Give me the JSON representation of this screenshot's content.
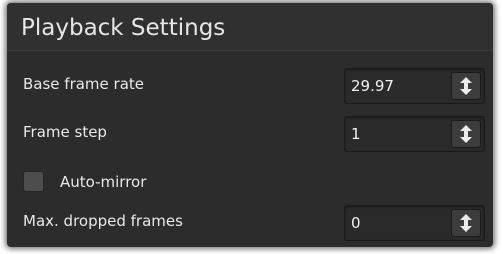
{
  "panel": {
    "title": "Playback Settings"
  },
  "settings": {
    "base_frame_rate": {
      "label": "Base frame rate",
      "value": "29.97"
    },
    "frame_step": {
      "label": "Frame step",
      "value": "1"
    },
    "auto_mirror": {
      "label": "Auto-mirror",
      "checked": false
    },
    "max_dropped_frames": {
      "label": "Max. dropped frames",
      "value": "0"
    }
  },
  "icons": {
    "spinner": "up-down-arrow-icon",
    "checkbox": "checkbox-unchecked"
  },
  "colors": {
    "panel_bg": "#2c2c2c",
    "field_bg": "#2a2a2a",
    "button_bg": "#3c3c3c",
    "text": "#e8e8e8"
  }
}
